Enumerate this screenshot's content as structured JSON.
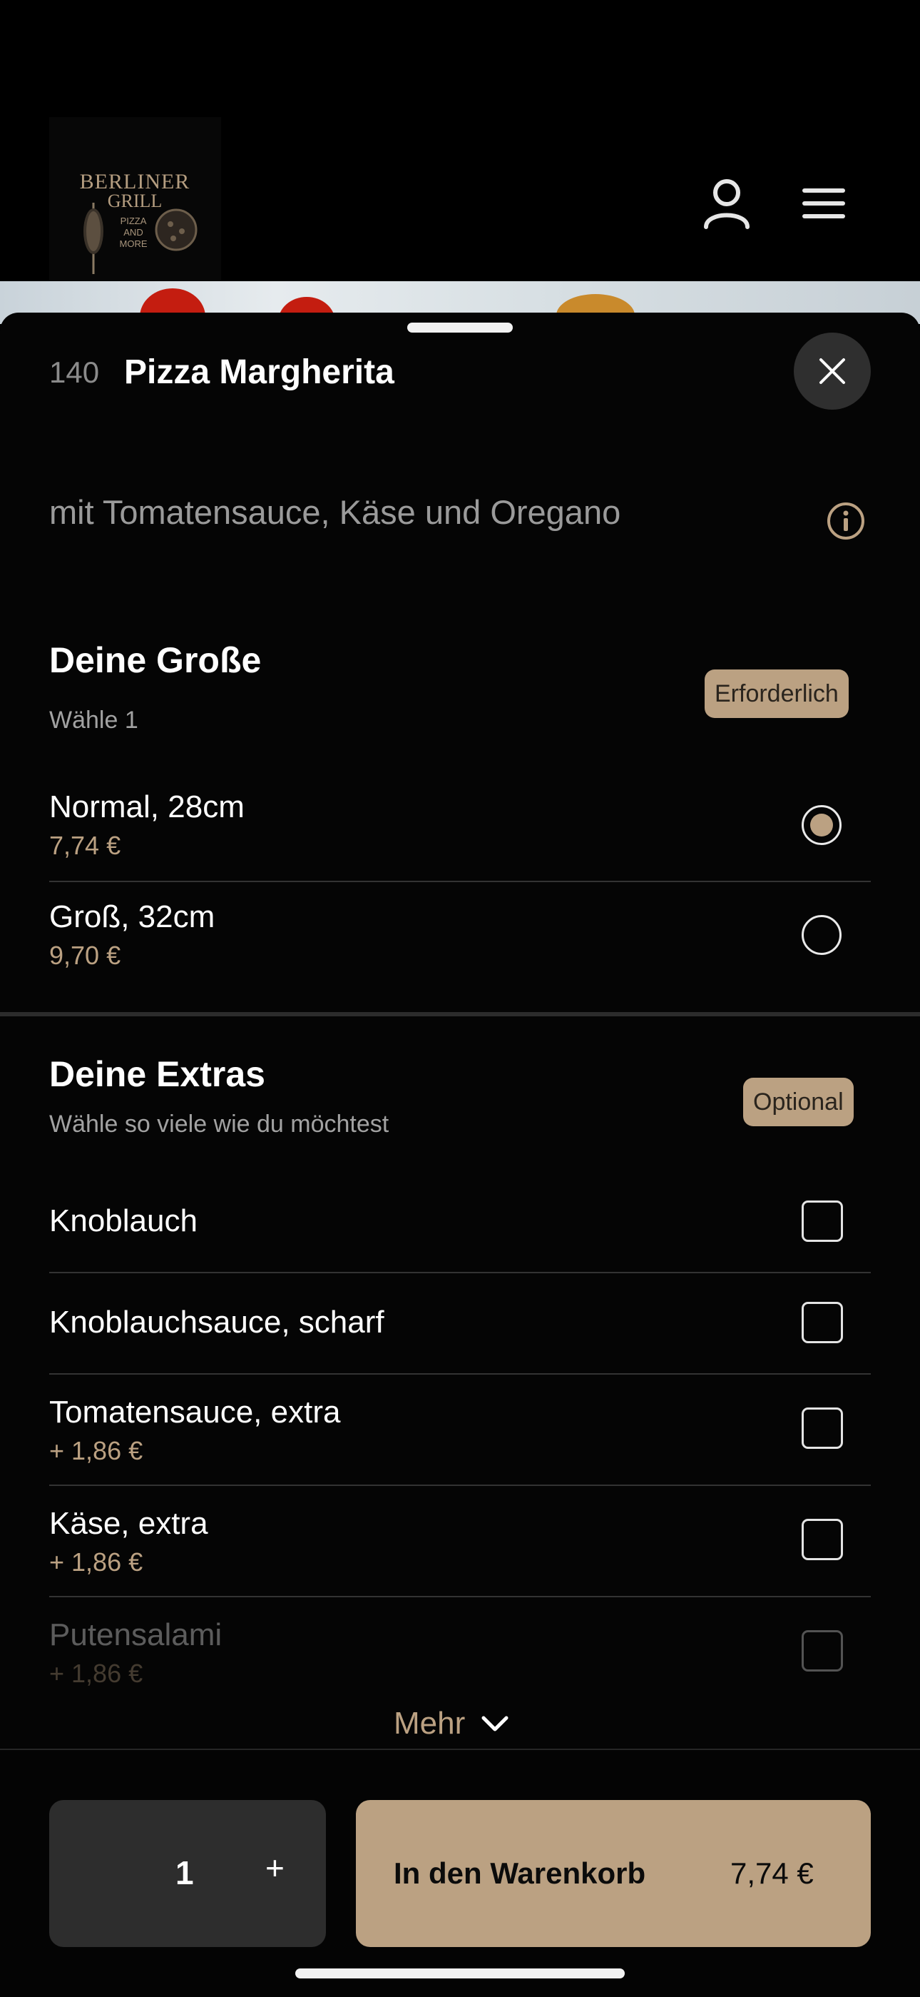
{
  "brand": {
    "logo_line1": "BERLINER",
    "logo_line2": "GRILL",
    "logo_sub1": "PIZZA",
    "logo_sub2": "AND",
    "logo_sub3": "MORE"
  },
  "header": {
    "account_icon": "person-icon",
    "menu_icon": "hamburger-menu-icon"
  },
  "item": {
    "number": "140",
    "title": "Pizza Margherita",
    "description": "mit Tomatensauce, Käse und Oregano",
    "close_icon": "close-icon",
    "info_icon": "info-icon"
  },
  "size_section": {
    "title": "Deine Große",
    "subtitle": "Wähle 1",
    "badge": "Erforderlich",
    "options": [
      {
        "label": "Normal, 28cm",
        "price": "7,74 €",
        "selected": true
      },
      {
        "label": "Groß, 32cm",
        "price": "9,70 €",
        "selected": false
      }
    ]
  },
  "extras_section": {
    "title": "Deine Extras",
    "subtitle": "Wähle so viele wie du möchtest",
    "badge": "Optional",
    "options": [
      {
        "label": "Knoblauch",
        "price": "",
        "checked": false
      },
      {
        "label": "Knoblauchsauce, scharf",
        "price": "",
        "checked": false
      },
      {
        "label": "Tomatensauce, extra",
        "price": "+ 1,86 €",
        "checked": false
      },
      {
        "label": "Käse, extra",
        "price": "+ 1,86 €",
        "checked": false
      },
      {
        "label": "Putensalami",
        "price": "+ 1,86 €",
        "checked": false
      }
    ],
    "more_label": "Mehr"
  },
  "footer": {
    "quantity": "1",
    "plus": "+",
    "add_to_cart": "In den Warenkorb",
    "total": "7,74 €"
  },
  "colors": {
    "accent": "#bba182",
    "background": "#050505",
    "muted_text": "#9a9a9a"
  }
}
